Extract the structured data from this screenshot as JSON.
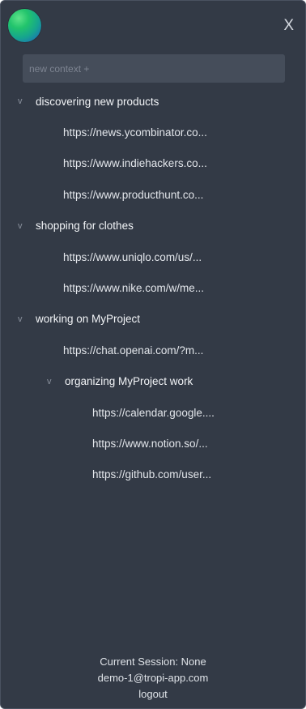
{
  "header": {
    "logo_icon": "globe-logo-icon",
    "close_label": "X"
  },
  "search": {
    "placeholder": "new context +"
  },
  "tree": {
    "contexts": [
      {
        "label": "discovering new products",
        "chevron": "v",
        "urls": [
          "https://news.ycombinator.co...",
          "https://www.indiehackers.co...",
          "https://www.producthunt.co..."
        ]
      },
      {
        "label": "shopping for clothes",
        "chevron": "v",
        "urls": [
          "https://www.uniqlo.com/us/...",
          "https://www.nike.com/w/me..."
        ]
      },
      {
        "label": "working on MyProject",
        "chevron": "v",
        "urls": [
          "https://chat.openai.com/?m..."
        ],
        "subcontexts": [
          {
            "label": "organizing MyProject work",
            "chevron": "v",
            "urls": [
              "https://calendar.google....",
              "https://www.notion.so/...",
              "https://github.com/user..."
            ]
          }
        ]
      }
    ]
  },
  "footer": {
    "session": "Current Session: None",
    "email": "demo-1@tropi-app.com",
    "logout": "logout"
  }
}
